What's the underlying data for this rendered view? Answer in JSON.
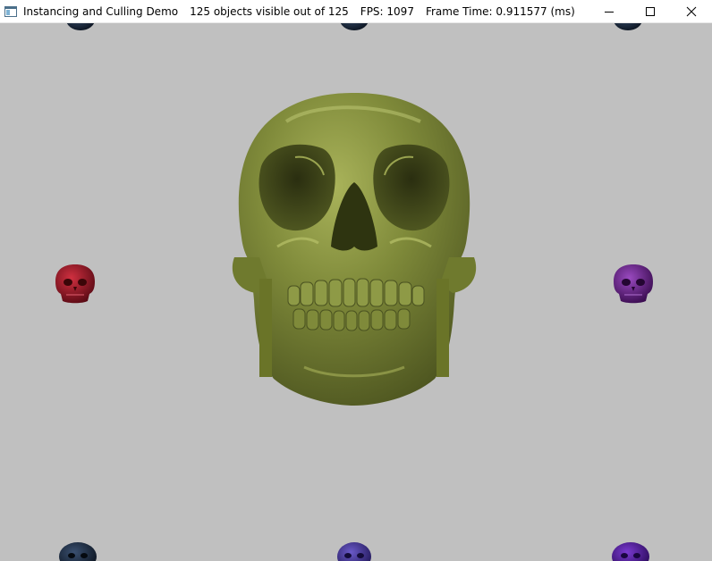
{
  "window": {
    "title": "Instancing and Culling Demo",
    "stats": "125 objects visible out of 125",
    "fps": "FPS: 1097",
    "frame_time": "Frame Time: 0.911577 (ms)"
  },
  "controls": {
    "minimize_icon": "minimize-icon",
    "maximize_icon": "maximize-icon",
    "close_icon": "close-icon"
  },
  "scene": {
    "background_color": "#c0c0c0",
    "main_skull_color": "#7f8a3a",
    "skull_colors": {
      "red": "#8a1020",
      "purple": "#5a1a78",
      "navy": "#1c2a40",
      "indigo": "#3a2a8a",
      "violet": "#4a1a90"
    }
  }
}
